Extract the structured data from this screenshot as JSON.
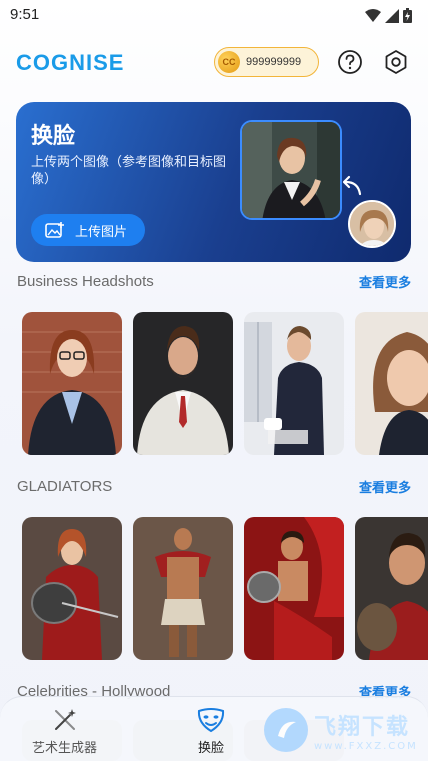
{
  "status_bar": {
    "time": "9:51"
  },
  "header": {
    "logo": "COGNISE",
    "coin_symbol": "CC",
    "coin_amount": "999999999",
    "icons": [
      "help-icon",
      "settings-icon"
    ]
  },
  "hero": {
    "title": "换脸",
    "subtitle": "上传两个图像（参考图像和目标图像）",
    "upload_label": "上传图片"
  },
  "sections": [
    {
      "title": "Business Headshots",
      "see_more": "查看更多"
    },
    {
      "title": "GLADIATORS",
      "see_more": "查看更多"
    },
    {
      "title": "Celebrities - Hollywood",
      "see_more": "查看更多"
    }
  ],
  "bottom_nav": {
    "items": [
      {
        "label": "艺术生成器",
        "icon": "magic-wand-icon"
      },
      {
        "label": "换脸",
        "icon": "face-mask-icon"
      }
    ]
  },
  "watermark": {
    "main": "飞翔下载",
    "sub": "www.FXXZ.COM"
  },
  "colors": {
    "accent": "#1a7ee0",
    "logo": "#1a9be8",
    "hero_bg": "#1a3f8f",
    "coin_border": "#f2b53a"
  }
}
